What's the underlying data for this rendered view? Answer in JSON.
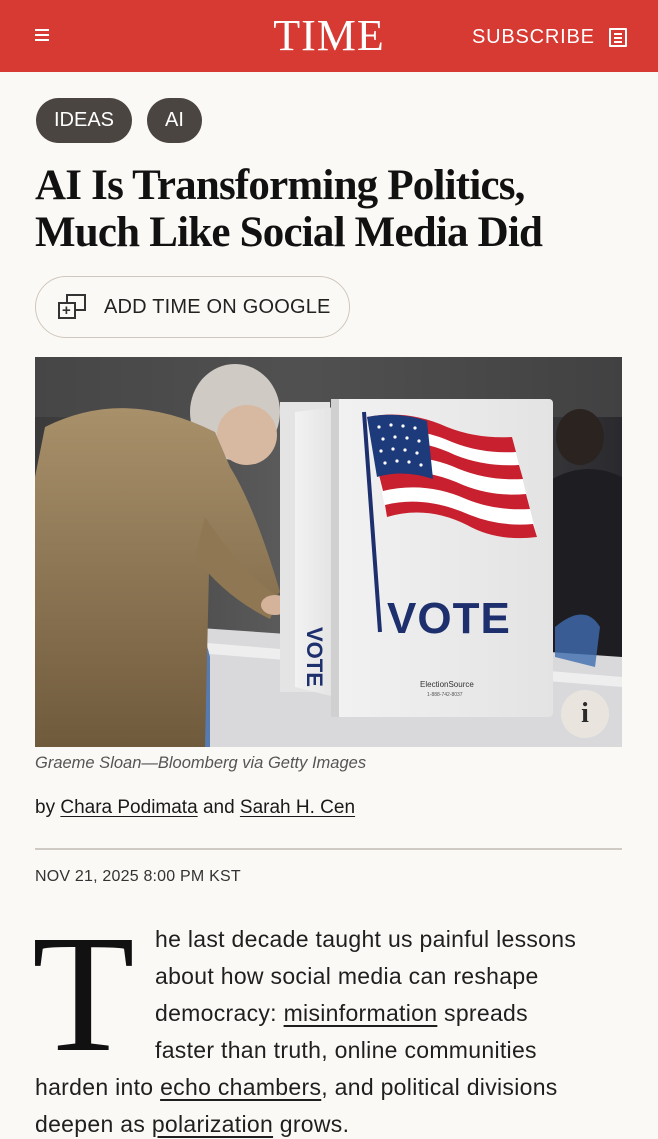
{
  "header": {
    "logo": "TIME",
    "subscribe_label": "SUBSCRIBE",
    "menu_icon": "hamburger-menu-icon",
    "subscribe_icon": "newspaper-icon",
    "brand_color": "#d63a32"
  },
  "tags": [
    "IDEAS",
    "AI"
  ],
  "article": {
    "headline_line1": "AI Is Transforming Politics,",
    "headline_line2": "Much Like Social Media Did",
    "google_button_label": "ADD TIME ON GOOGLE",
    "google_button_icon": "add-source-icon",
    "photo": {
      "sign_text": "VOTE",
      "side_sign_text": "VOTE",
      "booth_brand": "ElectionSource",
      "booth_phone": "1-888-742-8037",
      "info_button": "i",
      "credit": "Graeme Sloan—Bloomberg via Getty Images"
    },
    "byline": {
      "prefix": "by",
      "author1": "Chara Podimata",
      "conjunction": "and",
      "author2": "Sarah H. Cen"
    },
    "date": "NOV 21, 2025 8:00 PM KST",
    "drop_cap": "T",
    "body": {
      "l1": "he last decade taught us painful lessons",
      "l2": "about how social media can reshape",
      "l3_pre": "democracy: ",
      "l3_link": "misinformation",
      "l3_post": " spreads",
      "l4": "faster than truth, online communities",
      "l5_pre": "harden into ",
      "l5_link": "echo chambers",
      "l5_post": ", and political divisions",
      "l6_pre": "deepen as ",
      "l6_link": "polarization",
      "l6_post": " grows."
    }
  }
}
